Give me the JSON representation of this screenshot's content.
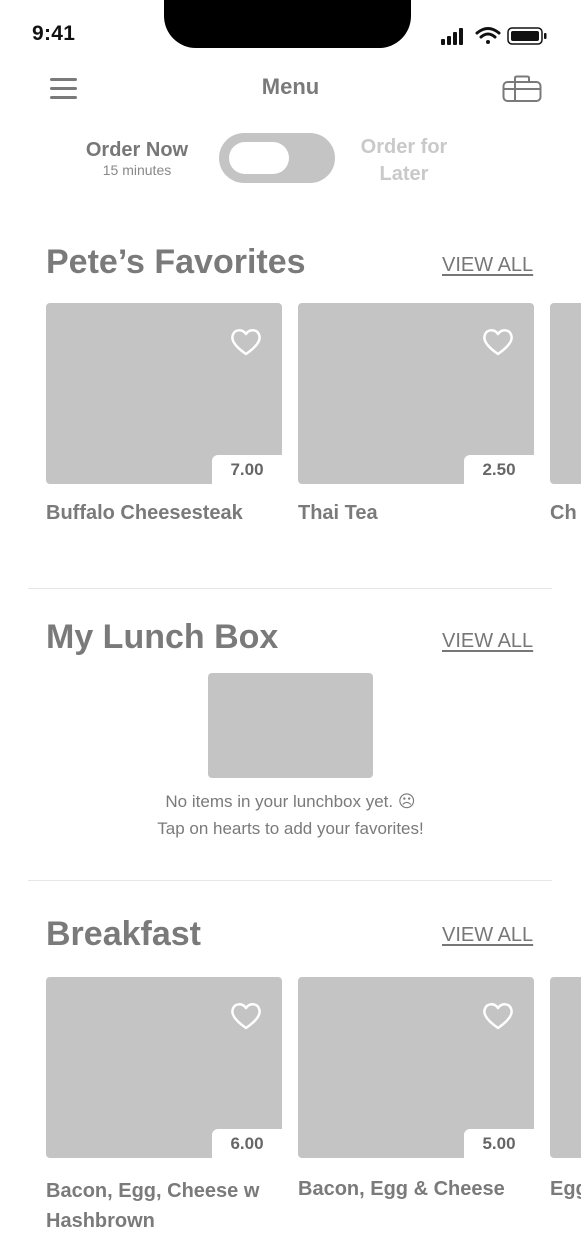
{
  "status_bar": {
    "time": "9:41"
  },
  "header": {
    "title": "Menu"
  },
  "order_toggle": {
    "now_label": "Order Now",
    "now_sub": "15 minutes",
    "later_label": "Order for Later"
  },
  "favorites": {
    "title": "Pete’s Favorites",
    "view_all": "VIEW ALL",
    "items": [
      {
        "name": "Buffalo Cheesesteak",
        "price": "7.00"
      },
      {
        "name": "Thai Tea",
        "price": "2.50"
      },
      {
        "name": "Ch"
      }
    ]
  },
  "lunchbox": {
    "title": "My Lunch Box",
    "view_all": "VIEW ALL",
    "empty_line1": "No items in your lunchbox yet. ☹",
    "empty_line2": "Tap on hearts to add your favorites!"
  },
  "breakfast": {
    "title": "Breakfast",
    "view_all": "VIEW ALL",
    "items": [
      {
        "name": "Bacon, Egg, Cheese w Hashbrown",
        "price": "6.00"
      },
      {
        "name": "Bacon, Egg & Cheese",
        "price": "5.00"
      },
      {
        "name": "Egg"
      }
    ]
  },
  "icons": [
    "menu-icon",
    "lunchbox-icon",
    "heart-icon",
    "signal-icon",
    "wifi-icon",
    "battery-icon"
  ],
  "colors": {
    "placeholder": "#c4c4c4",
    "text": "#7a7a7a",
    "inactive": "#c9c9c9"
  }
}
